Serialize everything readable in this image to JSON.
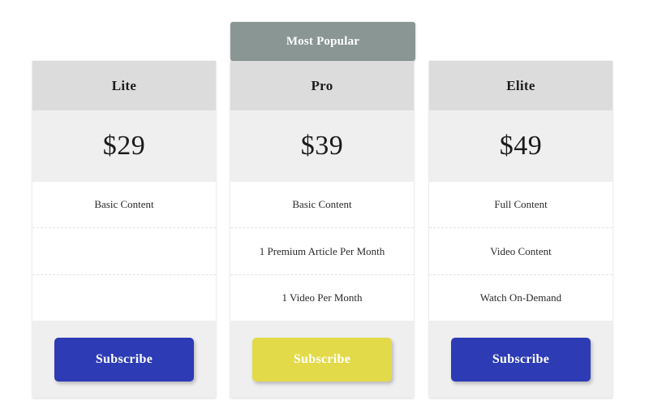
{
  "popular_banner": {
    "label": "Most Popular",
    "color": "#8a9694",
    "text_color": "#ffffff",
    "attached_to": "Pro"
  },
  "colors": {
    "page_background": "#ffffff",
    "card_background": "#ffffff",
    "header_background": "#dcdcdc",
    "price_background": "#efefef",
    "footer_background": "#efefef",
    "divider": "#e4e4e4",
    "button_blue": "#2d3bb5",
    "button_yellow": "#e3da4a",
    "button_text": "#ffffff",
    "heading_text": "#1b1b1b",
    "feature_text": "#2a2a2a"
  },
  "plans": [
    {
      "id": "lite",
      "name": "Lite",
      "price": "$29",
      "features": [
        "Basic Content",
        "",
        ""
      ],
      "cta": {
        "label": "Subscribe",
        "style": "blue",
        "color": "#2d3bb5"
      },
      "most_popular": false
    },
    {
      "id": "pro",
      "name": "Pro",
      "price": "$39",
      "features": [
        "Basic Content",
        "1 Premium Article Per Month",
        "1 Video Per Month"
      ],
      "cta": {
        "label": "Subscribe",
        "style": "yellow",
        "color": "#e3da4a"
      },
      "most_popular": true
    },
    {
      "id": "elite",
      "name": "Elite",
      "price": "$49",
      "features": [
        "Full Content",
        "Video Content",
        "Watch On-Demand"
      ],
      "cta": {
        "label": "Subscribe",
        "style": "blue",
        "color": "#2d3bb5"
      },
      "most_popular": false
    }
  ]
}
